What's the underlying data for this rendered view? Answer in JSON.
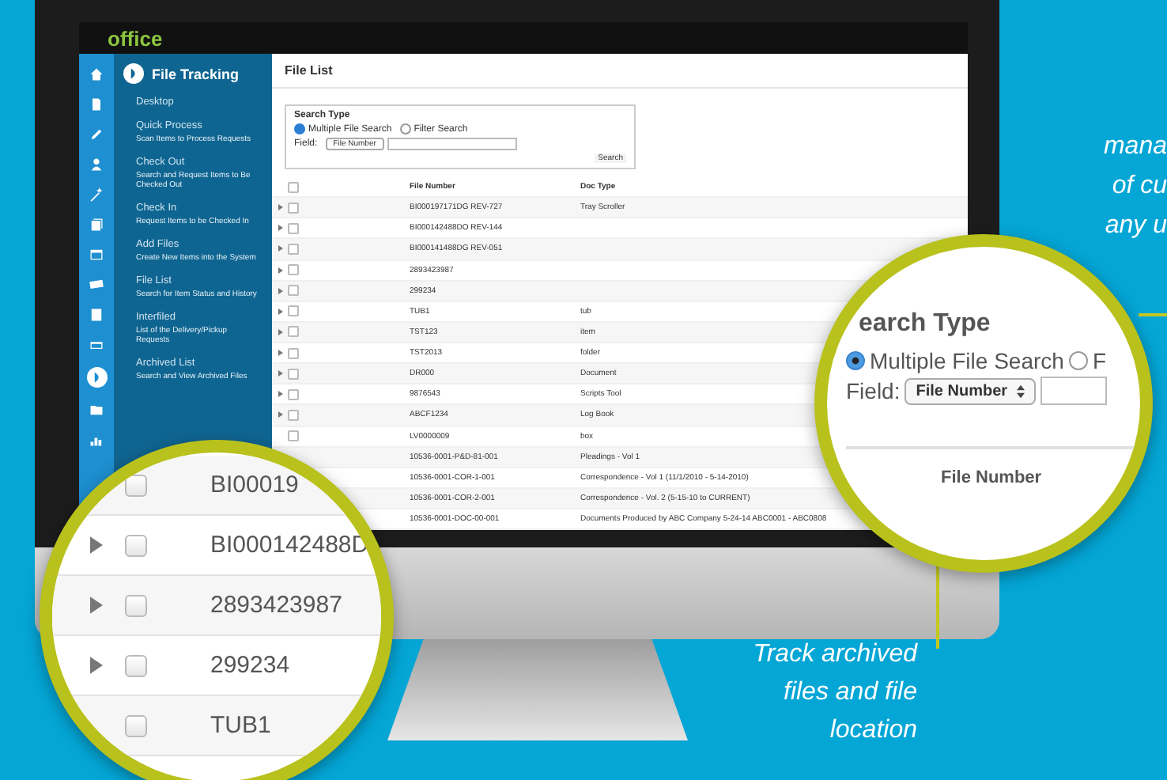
{
  "screen": {
    "logo": "office",
    "sidebar": {
      "title": "File Tracking",
      "items": [
        {
          "label": "Desktop"
        },
        {
          "label": "Quick Process",
          "description": "Scan Items to Process Requests"
        },
        {
          "label": "Check Out",
          "description": "Search and Request Items to Be Checked Out"
        },
        {
          "label": "Check In",
          "description": "Request Items to be Checked In"
        },
        {
          "label": "Add Files",
          "description": "Create New Items into the System"
        },
        {
          "label": "File List",
          "description": "Search for Item Status and History"
        },
        {
          "label": "Interfiled",
          "description": "List of the Delivery/Pickup Requests"
        },
        {
          "label": "Archived List",
          "description": "Search and View Archived Files"
        }
      ]
    },
    "main": {
      "title": "File List",
      "search": {
        "legend": "Search Type",
        "options": [
          {
            "label": "Multiple File Search",
            "selected": true
          },
          {
            "label": "Filter Search",
            "selected": false
          }
        ],
        "field_label": "Field:",
        "field_value": "File Number",
        "button": "Search"
      },
      "table": {
        "columns": [
          "File Number",
          "Doc Type"
        ],
        "header_checked": false,
        "rows": [
          {
            "file": "BI000197171DG REV-727",
            "type": "Tray Scroller",
            "expandable": true,
            "checked": false
          },
          {
            "file": "BI000142488DO REV-144",
            "expandable": true,
            "checked": false
          },
          {
            "file": "BI000141488DG REV-051",
            "expandable": true,
            "checked": false
          },
          {
            "file": "2893423987",
            "expandable": true,
            "checked": false
          },
          {
            "file": "299234",
            "expandable": true,
            "checked": false
          },
          {
            "file": "TUB1",
            "type": "tub",
            "expandable": true,
            "checked": false
          },
          {
            "file": "TST123",
            "type": "item",
            "expandable": true,
            "checked": false
          },
          {
            "file": "TST2013",
            "type": "folder",
            "expandable": true,
            "checked": false
          },
          {
            "file": "DR000",
            "type": "Document",
            "expandable": true,
            "checked": false
          },
          {
            "file": "9876543",
            "type": "Scripts Tool",
            "expandable": true,
            "checked": false
          },
          {
            "file": "ABCF1234",
            "type": "Log Book",
            "expandable": true,
            "checked": false
          },
          {
            "file": "LV0000009",
            "type": "box",
            "expandable": false,
            "checked": false
          },
          {
            "file": "10536-0001-P&D-81-001",
            "type": "Pleadings - Vol 1"
          },
          {
            "file": "10536-0001-COR-1-001",
            "type": "Correspondence - Vol 1 (11/1/2010 - 5-14-2010)"
          },
          {
            "file": "10536-0001-COR-2-001",
            "type": "Correspondence - Vol. 2 (5-15-10 to CURRENT)"
          },
          {
            "file": "10536-0001-DOC-00-001",
            "type": "Documents Produced by ABC Company 5-24-14 ABC0001 - ABC0808"
          }
        ]
      }
    }
  },
  "zoom_rows": [
    {
      "file": "BI00019",
      "expandable": false,
      "checked": false
    },
    {
      "file": "BI000142488D",
      "expandable": true,
      "checked": false
    },
    {
      "file": "2893423987",
      "expandable": true,
      "checked": false
    },
    {
      "file": "299234",
      "expandable": true,
      "checked": false
    },
    {
      "file": "TUB1",
      "expandable": false,
      "checked": false
    }
  ],
  "zoom_search": {
    "legend": "earch Type",
    "options": [
      {
        "label": "Multiple File Search",
        "selected": true
      },
      {
        "label": "F",
        "selected": false
      }
    ],
    "field_label": "Field:",
    "field_value": "File Number",
    "column": "File Number"
  },
  "caption_right": [
    "mana",
    "of cu",
    "any u"
  ],
  "caption_bottom": [
    "Track archived",
    "files and file",
    "location"
  ]
}
